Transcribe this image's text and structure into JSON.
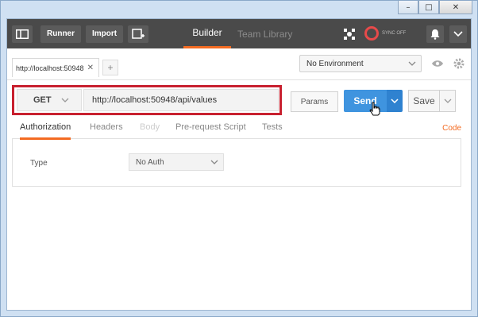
{
  "window": {
    "minimize": "–",
    "maximize": "□",
    "close": "✕"
  },
  "header": {
    "runner": "Runner",
    "import": "Import",
    "tabs": [
      {
        "label": "Builder"
      },
      {
        "label": "Team Library"
      }
    ],
    "sync": "SYNC OFF",
    "icons": [
      "sidebar-icon",
      "new-window-icon",
      "satellite-icon",
      "sync-icon",
      "bell-icon",
      "chevron-down-icon"
    ]
  },
  "tabs": {
    "request_tab": "http://localhost:50948",
    "close": "✕",
    "add": "+"
  },
  "environment": {
    "selected": "No Environment"
  },
  "request": {
    "method": "GET",
    "url": "http://localhost:50948/api/values",
    "params": "Params",
    "send": "Send",
    "save": "Save"
  },
  "subtabs": [
    {
      "label": "Authorization",
      "state": "active"
    },
    {
      "label": "Headers",
      "state": "normal"
    },
    {
      "label": "Body",
      "state": "disabled"
    },
    {
      "label": "Pre-request Script",
      "state": "normal"
    },
    {
      "label": "Tests",
      "state": "normal"
    }
  ],
  "code_link": "Code",
  "auth": {
    "type_label": "Type",
    "selected": "No Auth"
  },
  "colors": {
    "accent": "#f36b22",
    "send": "#3f94df",
    "highlight": "#c8202f",
    "header_bg": "#4a4a4a"
  }
}
